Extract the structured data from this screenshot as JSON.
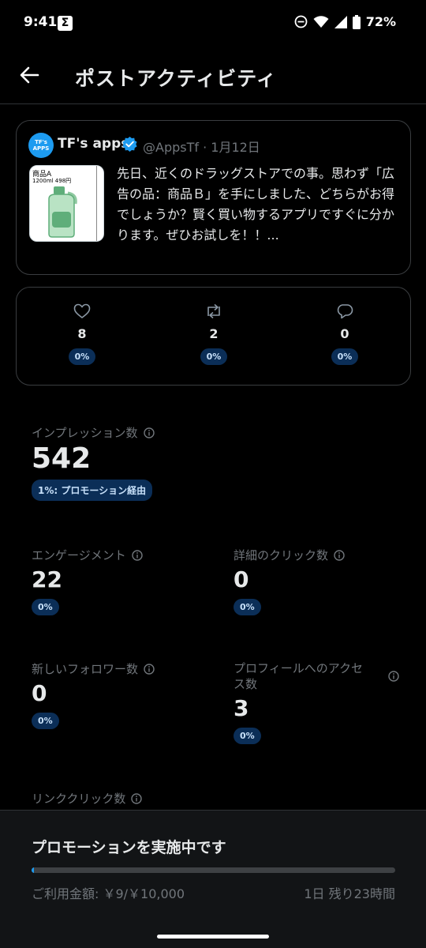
{
  "status": {
    "time": "9:41",
    "battery": "72%",
    "sigma": "Σ"
  },
  "header": {
    "title": "ポストアクティビティ"
  },
  "tweet": {
    "author_name": "TF's apps",
    "handle_date": "@AppsTf · 1月12日",
    "avatar_text": "TF's APPS",
    "media_label1": "商品A",
    "media_label2": "1200ml  498円",
    "text": "先日、近くのドラッグストアでの事。思わず「広告の品：商品Ｂ」を手にしました、どちらがお得でしょうか？賢く買い物するアプリですぐに分かります。ぜひお試しを！！..."
  },
  "engagement_bar": {
    "likes": {
      "icon": "heart-icon",
      "count": "8",
      "pct": "0%"
    },
    "reposts": {
      "icon": "repost-icon",
      "count": "2",
      "pct": "0%"
    },
    "replies": {
      "icon": "reply-icon",
      "count": "0",
      "pct": "0%"
    }
  },
  "metrics": {
    "impressions": {
      "label": "インプレッション数",
      "value": "542",
      "badge": "1%: プロモーション経由"
    },
    "engagements": {
      "label": "エンゲージメント",
      "value": "22",
      "pct": "0%"
    },
    "detail_clicks": {
      "label": "詳細のクリック数",
      "value": "0",
      "pct": "0%"
    },
    "new_followers": {
      "label": "新しいフォロワー数",
      "value": "0",
      "pct": "0%"
    },
    "profile_visits": {
      "label_line1": "プロフィールへのアクセ",
      "label_line2": "ス数",
      "value": "3",
      "pct": "0%"
    },
    "link_clicks": {
      "label": "リンククリック数"
    }
  },
  "promotion": {
    "title": "プロモーションを実施中です",
    "progress_fraction": 0.0009,
    "spend": "ご利用金額: ￥9/￥10,000",
    "remaining": "1日 残り23時間"
  },
  "colors": {
    "accent": "#1d9bf0",
    "pill_bg": "#0b2e57",
    "muted": "#71767b"
  }
}
